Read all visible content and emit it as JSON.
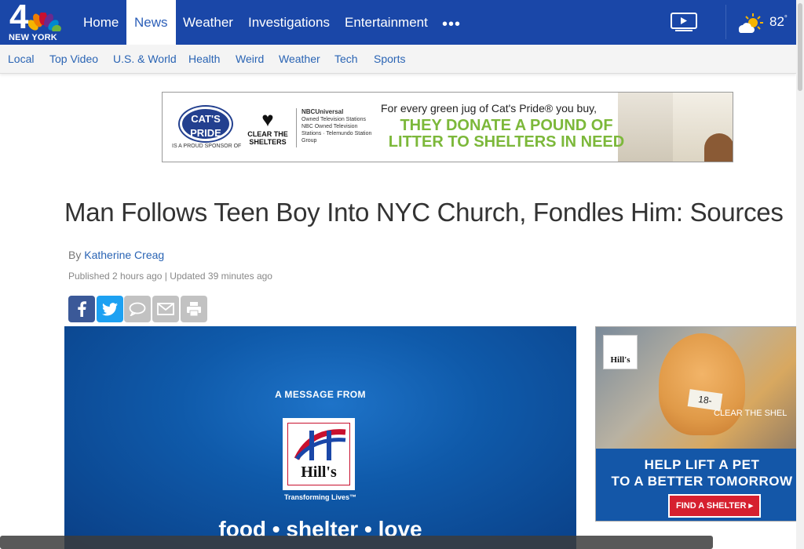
{
  "header": {
    "logo_number": "4",
    "logo_city": "NEW YORK",
    "nav": [
      {
        "label": "Home"
      },
      {
        "label": "News",
        "active": true
      },
      {
        "label": "Weather"
      },
      {
        "label": "Investigations"
      },
      {
        "label": "Entertainment"
      }
    ],
    "more_icon": "more-dots-icon",
    "video_icon": "play-video-icon",
    "weather_icon": "partly-cloudy-icon",
    "temperature": "82",
    "temperature_unit": "°"
  },
  "subnav": {
    "items": [
      "Local",
      "Top Video",
      "U.S. & World",
      "Health",
      "Weird",
      "Weather",
      "Tech",
      "Sports"
    ]
  },
  "banner_ad": {
    "brand": "CAT'S PRIDE",
    "sponsor_text": "IS A PROUD SPONSOR OF",
    "cts_label": "CLEAR THE SHELTERS",
    "nbcu_label": "NBCUniversal",
    "nbcu_sub": "Owned Television Stations",
    "nbcu_small": "NBC Owned Television Stations · Telemundo Station Group",
    "line1": "For every green jug of Cat's Pride® you buy,",
    "line2": "THEY DONATE A POUND OF LITTER TO SHELTERS IN NEED"
  },
  "article": {
    "headline": "Man Follows Teen Boy Into NYC Church, Fondles Him: Sources",
    "by_prefix": "By",
    "author": "Katherine Creag",
    "published": "Published 2 hours ago | Updated 39 minutes ago",
    "share_buttons": [
      "facebook-icon",
      "twitter-icon",
      "comment-icon",
      "email-icon",
      "print-icon"
    ]
  },
  "video": {
    "message": "A MESSAGE FROM",
    "brand": "Hill's",
    "brand_tagline": "Transforming Lives™",
    "tagline": "food • shelter • love"
  },
  "side_ad": {
    "brand": "Hill's",
    "cage_tag": "18-",
    "cts_label": "CLEAR THE SHEL",
    "headline_1": "HELP LIFT A PET",
    "headline_2": "TO A BETTER TOMORROW",
    "cta": "FIND A SHELTER ▸"
  },
  "colors": {
    "nav_blue": "#1a47a8",
    "link_blue": "#2a64b4",
    "facebook": "#3b5998",
    "twitter": "#1da1f2",
    "cta_red": "#d6202f",
    "litter_green": "#7cb83a"
  }
}
